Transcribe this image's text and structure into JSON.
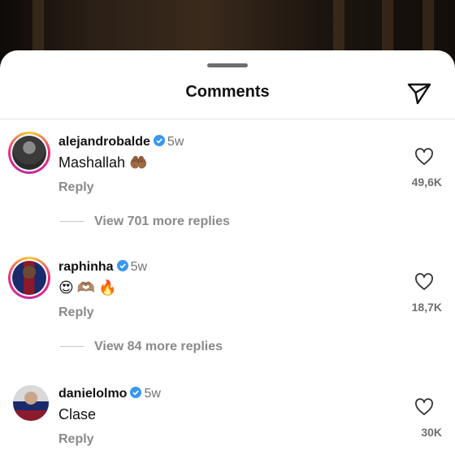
{
  "header": {
    "title": "Comments",
    "share_icon": "paper-plane-icon"
  },
  "comments": [
    {
      "username": "alejandrobalde",
      "verified": true,
      "age": "5w",
      "text": "Mashallah 🤲🏾",
      "reply_label": "Reply",
      "likes": "49,6K",
      "view_replies": "View 701 more replies",
      "story_ring": true
    },
    {
      "username": "raphinha",
      "verified": true,
      "age": "5w",
      "text": "😍🫶🏽🔥",
      "reply_label": "Reply",
      "likes": "18,7K",
      "view_replies": "View 84 more replies",
      "story_ring": true
    },
    {
      "username": "danielolmo",
      "verified": true,
      "age": "5w",
      "text": "Clase",
      "reply_label": "Reply",
      "likes": "30K",
      "story_ring": false
    }
  ],
  "colors": {
    "verified_blue": "#3897f0",
    "muted_text": "#737373",
    "story_ring": "#ee2a7b"
  }
}
